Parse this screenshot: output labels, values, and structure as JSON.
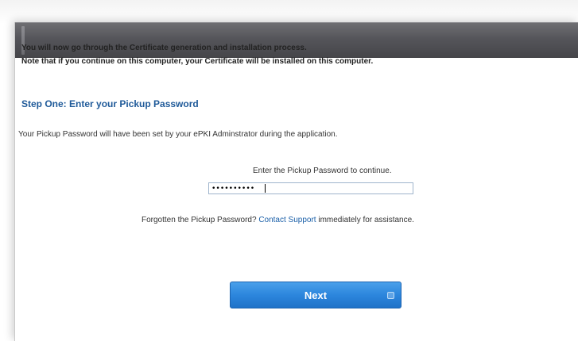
{
  "intro": {
    "line1": "You will now go through the Certificate generation and installation process.",
    "line2": "Note that if you continue on this computer, your Certificate will be installed on this computer."
  },
  "step": {
    "title": "Step One: Enter your Pickup Password",
    "description": "Your Pickup Password will have been set by your ePKI Adminstrator during the application."
  },
  "password": {
    "label": "Enter the Pickup Password to continue.",
    "value": "••••••••••"
  },
  "help": {
    "prefix": "Forgotten the Pickup Password? ",
    "link": "Contact Support",
    "suffix": " immediately for assistance."
  },
  "buttons": {
    "next_label": "Next"
  },
  "colors": {
    "title_bar": "#55555a",
    "step_title": "#1f5a99",
    "link": "#1a5fa8",
    "next_button": "#2c86dd"
  }
}
